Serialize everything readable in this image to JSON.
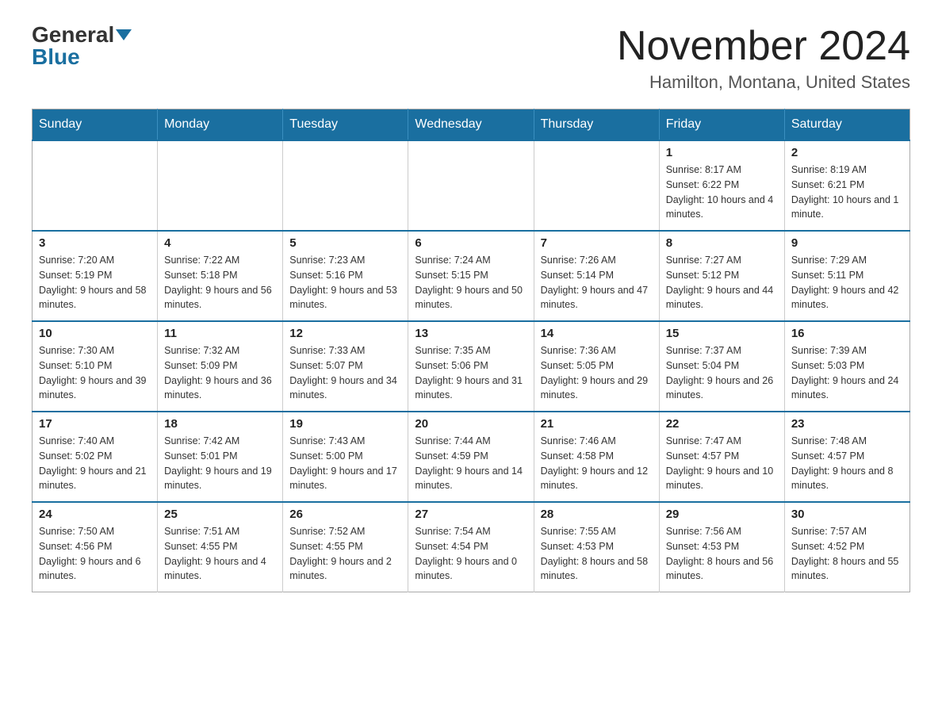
{
  "logo": {
    "general": "General",
    "blue": "Blue"
  },
  "header": {
    "month": "November 2024",
    "location": "Hamilton, Montana, United States"
  },
  "weekdays": [
    "Sunday",
    "Monday",
    "Tuesday",
    "Wednesday",
    "Thursday",
    "Friday",
    "Saturday"
  ],
  "weeks": [
    [
      {
        "day": "",
        "info": ""
      },
      {
        "day": "",
        "info": ""
      },
      {
        "day": "",
        "info": ""
      },
      {
        "day": "",
        "info": ""
      },
      {
        "day": "",
        "info": ""
      },
      {
        "day": "1",
        "info": "Sunrise: 8:17 AM\nSunset: 6:22 PM\nDaylight: 10 hours and 4 minutes."
      },
      {
        "day": "2",
        "info": "Sunrise: 8:19 AM\nSunset: 6:21 PM\nDaylight: 10 hours and 1 minute."
      }
    ],
    [
      {
        "day": "3",
        "info": "Sunrise: 7:20 AM\nSunset: 5:19 PM\nDaylight: 9 hours and 58 minutes."
      },
      {
        "day": "4",
        "info": "Sunrise: 7:22 AM\nSunset: 5:18 PM\nDaylight: 9 hours and 56 minutes."
      },
      {
        "day": "5",
        "info": "Sunrise: 7:23 AM\nSunset: 5:16 PM\nDaylight: 9 hours and 53 minutes."
      },
      {
        "day": "6",
        "info": "Sunrise: 7:24 AM\nSunset: 5:15 PM\nDaylight: 9 hours and 50 minutes."
      },
      {
        "day": "7",
        "info": "Sunrise: 7:26 AM\nSunset: 5:14 PM\nDaylight: 9 hours and 47 minutes."
      },
      {
        "day": "8",
        "info": "Sunrise: 7:27 AM\nSunset: 5:12 PM\nDaylight: 9 hours and 44 minutes."
      },
      {
        "day": "9",
        "info": "Sunrise: 7:29 AM\nSunset: 5:11 PM\nDaylight: 9 hours and 42 minutes."
      }
    ],
    [
      {
        "day": "10",
        "info": "Sunrise: 7:30 AM\nSunset: 5:10 PM\nDaylight: 9 hours and 39 minutes."
      },
      {
        "day": "11",
        "info": "Sunrise: 7:32 AM\nSunset: 5:09 PM\nDaylight: 9 hours and 36 minutes."
      },
      {
        "day": "12",
        "info": "Sunrise: 7:33 AM\nSunset: 5:07 PM\nDaylight: 9 hours and 34 minutes."
      },
      {
        "day": "13",
        "info": "Sunrise: 7:35 AM\nSunset: 5:06 PM\nDaylight: 9 hours and 31 minutes."
      },
      {
        "day": "14",
        "info": "Sunrise: 7:36 AM\nSunset: 5:05 PM\nDaylight: 9 hours and 29 minutes."
      },
      {
        "day": "15",
        "info": "Sunrise: 7:37 AM\nSunset: 5:04 PM\nDaylight: 9 hours and 26 minutes."
      },
      {
        "day": "16",
        "info": "Sunrise: 7:39 AM\nSunset: 5:03 PM\nDaylight: 9 hours and 24 minutes."
      }
    ],
    [
      {
        "day": "17",
        "info": "Sunrise: 7:40 AM\nSunset: 5:02 PM\nDaylight: 9 hours and 21 minutes."
      },
      {
        "day": "18",
        "info": "Sunrise: 7:42 AM\nSunset: 5:01 PM\nDaylight: 9 hours and 19 minutes."
      },
      {
        "day": "19",
        "info": "Sunrise: 7:43 AM\nSunset: 5:00 PM\nDaylight: 9 hours and 17 minutes."
      },
      {
        "day": "20",
        "info": "Sunrise: 7:44 AM\nSunset: 4:59 PM\nDaylight: 9 hours and 14 minutes."
      },
      {
        "day": "21",
        "info": "Sunrise: 7:46 AM\nSunset: 4:58 PM\nDaylight: 9 hours and 12 minutes."
      },
      {
        "day": "22",
        "info": "Sunrise: 7:47 AM\nSunset: 4:57 PM\nDaylight: 9 hours and 10 minutes."
      },
      {
        "day": "23",
        "info": "Sunrise: 7:48 AM\nSunset: 4:57 PM\nDaylight: 9 hours and 8 minutes."
      }
    ],
    [
      {
        "day": "24",
        "info": "Sunrise: 7:50 AM\nSunset: 4:56 PM\nDaylight: 9 hours and 6 minutes."
      },
      {
        "day": "25",
        "info": "Sunrise: 7:51 AM\nSunset: 4:55 PM\nDaylight: 9 hours and 4 minutes."
      },
      {
        "day": "26",
        "info": "Sunrise: 7:52 AM\nSunset: 4:55 PM\nDaylight: 9 hours and 2 minutes."
      },
      {
        "day": "27",
        "info": "Sunrise: 7:54 AM\nSunset: 4:54 PM\nDaylight: 9 hours and 0 minutes."
      },
      {
        "day": "28",
        "info": "Sunrise: 7:55 AM\nSunset: 4:53 PM\nDaylight: 8 hours and 58 minutes."
      },
      {
        "day": "29",
        "info": "Sunrise: 7:56 AM\nSunset: 4:53 PM\nDaylight: 8 hours and 56 minutes."
      },
      {
        "day": "30",
        "info": "Sunrise: 7:57 AM\nSunset: 4:52 PM\nDaylight: 8 hours and 55 minutes."
      }
    ]
  ]
}
